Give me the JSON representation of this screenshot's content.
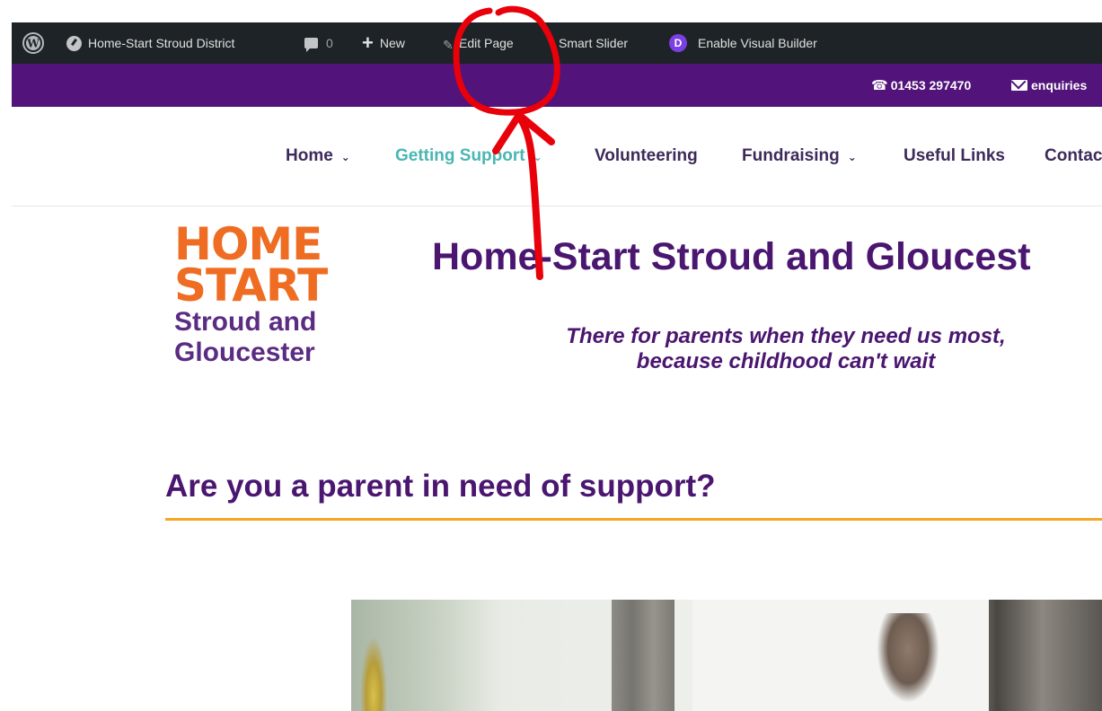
{
  "admin_bar": {
    "site_name": "Home-Start Stroud District",
    "comments_count": "0",
    "new_label": "New",
    "edit_page_label": "Edit Page",
    "smart_slider_label": "Smart Slider",
    "visual_builder_label": "Enable Visual Builder",
    "divi_letter": "D"
  },
  "contact_bar": {
    "phone": "01453 297470",
    "email": "enquiries"
  },
  "nav": {
    "items": [
      {
        "label": "Home",
        "dropdown": true,
        "active": false
      },
      {
        "label": "Getting Support",
        "dropdown": true,
        "active": true
      },
      {
        "label": "Volunteering",
        "dropdown": false,
        "active": false
      },
      {
        "label": "Fundraising",
        "dropdown": true,
        "active": false
      },
      {
        "label": "Useful Links",
        "dropdown": false,
        "active": false
      },
      {
        "label": "Contac",
        "dropdown": false,
        "active": false
      }
    ]
  },
  "logo": {
    "line1": "HOME",
    "line2": "START",
    "line3": "Stroud and",
    "line4": "Gloucester"
  },
  "header": {
    "title": "Home-Start Stroud and Gloucest",
    "tagline_line1": "There for parents when they need us most,",
    "tagline_line2": "because childhood can't wait"
  },
  "main": {
    "section_heading": "Are you a parent in need of support?"
  },
  "colors": {
    "admin_bar": "#1d2327",
    "brand_purple": "#52137a",
    "heading_purple": "#4a1670",
    "logo_orange": "#ef6c23",
    "active_nav": "#4ab6b4",
    "heading_rule": "#f5a623",
    "annotation_red": "#e8000a"
  }
}
